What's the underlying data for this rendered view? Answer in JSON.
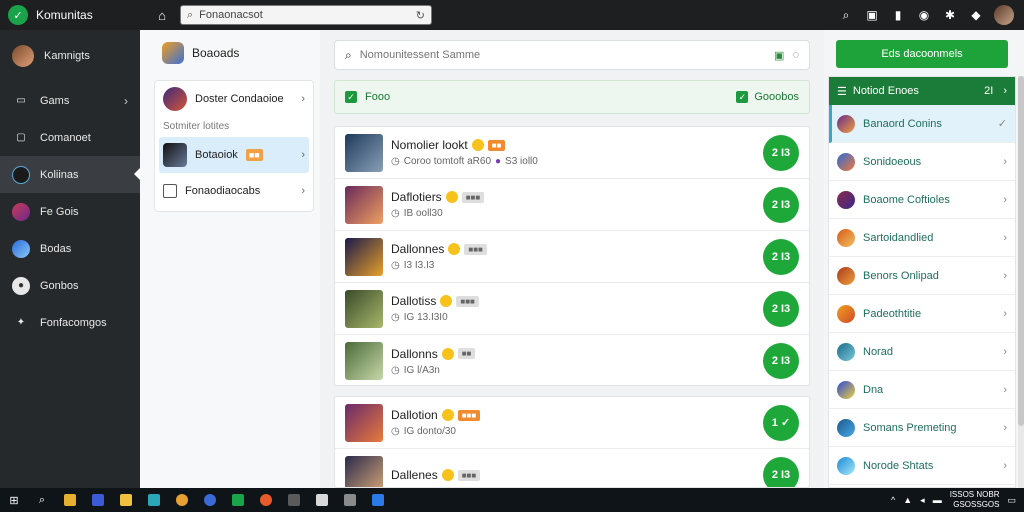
{
  "app": {
    "title": "Komunitas"
  },
  "top_search": {
    "value": "Fonaonacsot"
  },
  "sidebar": {
    "items": [
      {
        "label": "Kamnigts",
        "icon": "avatar-icon"
      },
      {
        "label": "Gams",
        "icon": "gamepad-icon"
      },
      {
        "label": "Comanoet",
        "icon": "monitor-icon"
      },
      {
        "label": "Koliinas",
        "icon": "sword-icon"
      },
      {
        "label": "Fe Gois",
        "icon": "game-icon"
      },
      {
        "label": "Bodas",
        "icon": "globe-icon"
      },
      {
        "label": "Gonbos",
        "icon": "avatar-icon"
      },
      {
        "label": "Fonfacomgos",
        "icon": "puzzle-icon"
      }
    ]
  },
  "col2": {
    "header": "Boaoads",
    "items": [
      {
        "label": "Doster Condaoioe"
      }
    ],
    "sub_label": "Sotmiter lotites",
    "selected_item": {
      "label": "Botaoiok",
      "tag": ""
    },
    "bottom_item": {
      "label": "Fonaodiaocabs"
    }
  },
  "main": {
    "search_placeholder": "Nomounitessent Samme",
    "filter_label": "Fooo",
    "filter_right": "Gooobos",
    "rows": [
      {
        "title": "Nomolier lookt",
        "meta": "Coroo tomtoft aR60",
        "meta2": "S3 ioll0",
        "button": "2 I3"
      },
      {
        "title": "Daflotiers",
        "meta": "IB ooll30",
        "button": "2 I3"
      },
      {
        "title": "Dallonnes",
        "meta": "I3 I3.I3",
        "button": "2 I3"
      },
      {
        "title": "Dallotiss",
        "meta": "IG 13.I3I0",
        "button": "2 I3"
      },
      {
        "title": "Dallonns",
        "meta": "IG l/A3n",
        "button": "2 I3"
      },
      {
        "title": "Dallotion",
        "meta": "IG donto/30",
        "button": "1 ✓"
      },
      {
        "title": "Dallenes",
        "meta": "",
        "button": "2 I3"
      }
    ]
  },
  "right": {
    "button_label": "Eds dacoonmels",
    "header_label": "Notiod Enoes",
    "header_count": "2I",
    "items": [
      {
        "label": "Banaord Conins"
      },
      {
        "label": "Sonidoeous"
      },
      {
        "label": "Boaome Coftioles"
      },
      {
        "label": "Sartoidandlied"
      },
      {
        "label": "Benors Onlipad"
      },
      {
        "label": "Padeothtitie"
      },
      {
        "label": "Norad"
      },
      {
        "label": "Dna"
      },
      {
        "label": "Somans Premeting"
      },
      {
        "label": "Norode Shtats"
      }
    ]
  },
  "taskbar": {
    "time": "ISSOS NOBR",
    "date": "GSOSSGOS"
  },
  "colors": {
    "accent": "#1ea33b",
    "sidebar_bg": "#26292c",
    "header_green": "#1a7c38"
  }
}
